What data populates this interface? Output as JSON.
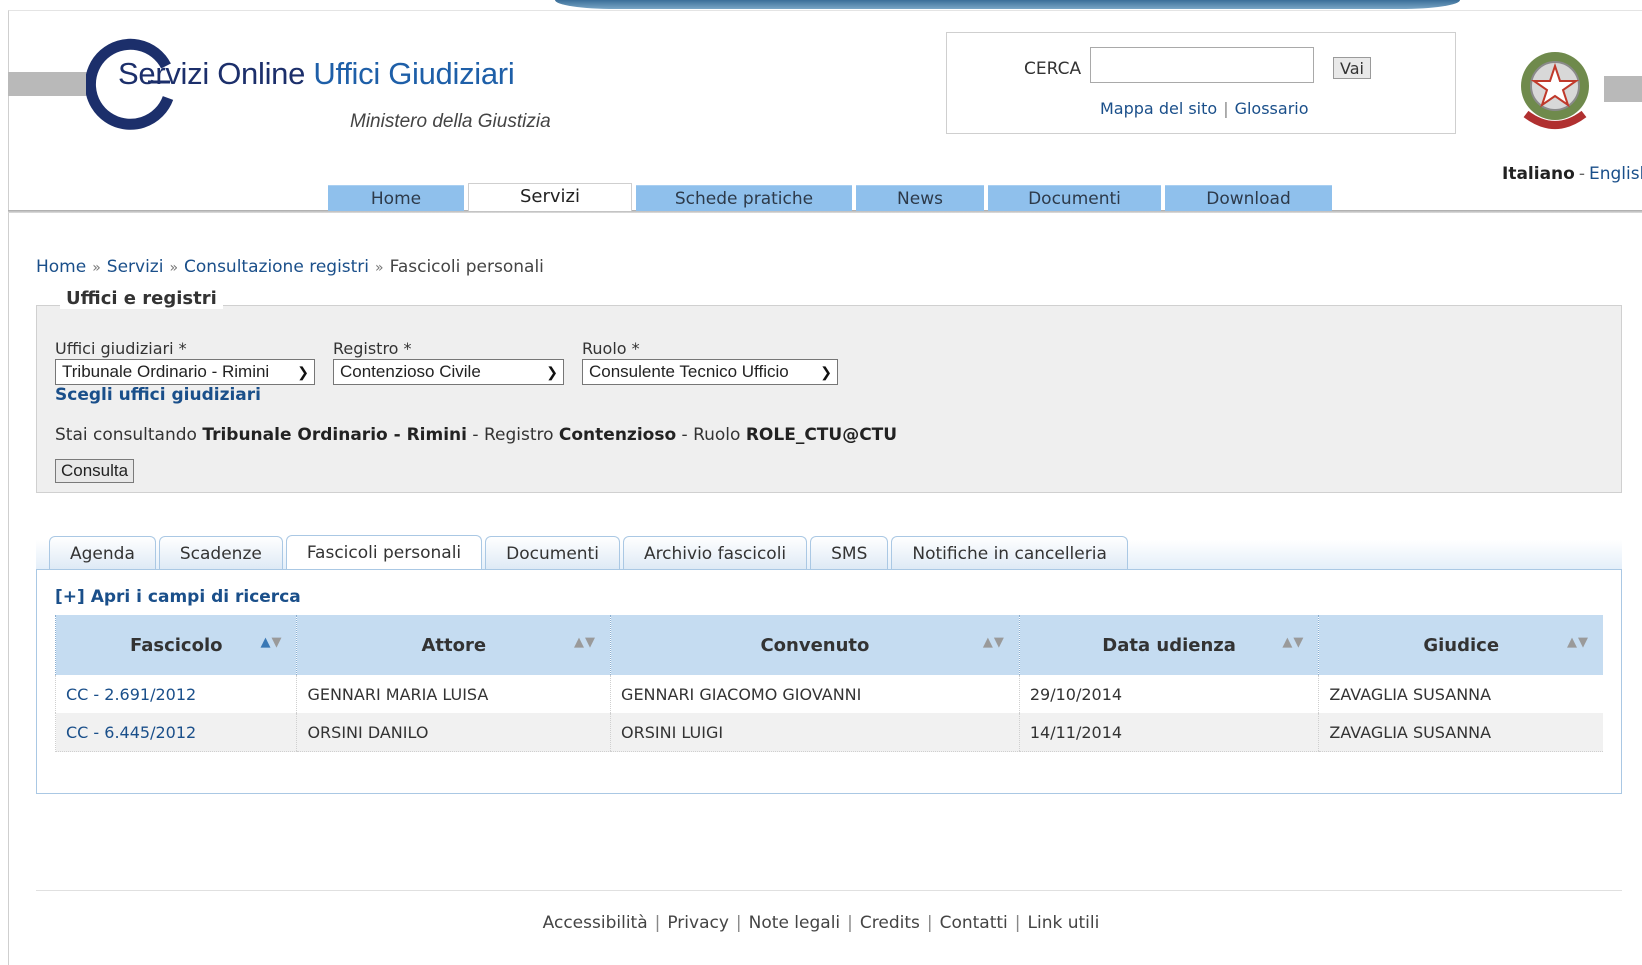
{
  "header": {
    "brand_part1": "Servizi Online",
    "brand_part2": "Uffici Giudiziari",
    "subtitle": "Ministero della Giustizia",
    "search_label": "CERCA",
    "search_value": "",
    "search_button": "Vai",
    "links": [
      "Mappa del sito",
      "Glossario"
    ],
    "lang_current": "Italiano",
    "lang_other": "English",
    "separator_pipe": "|",
    "separator_dash": "-"
  },
  "nav": {
    "items": [
      "Home",
      "Servizi",
      "Schede pratiche",
      "News",
      "Documenti",
      "Download"
    ],
    "active": "Servizi"
  },
  "breadcrumb": [
    "Home",
    "Servizi",
    "Consultazione registri",
    "Fascicoli personali"
  ],
  "form": {
    "legend": "Uffici e registri",
    "uffici_label": "Uffici giudiziari *",
    "uffici_value": "Tribunale Ordinario - Rimini",
    "registro_label": "Registro *",
    "registro_value": "Contenzioso Civile",
    "ruolo_label": "Ruolo *",
    "ruolo_value": "Consulente Tecnico Ufficio",
    "scegli_link": "Scegli uffici giudiziari",
    "status_prefix": "Stai consultando",
    "status_ufficio": "Tribunale Ordinario - Rimini",
    "status_registro_label": "Registro",
    "status_registro": "Contenzioso",
    "status_ruolo_label": "Ruolo",
    "status_ruolo": "ROLE_CTU@CTU",
    "consulta_button": "Consulta"
  },
  "tabs": {
    "items": [
      "Agenda",
      "Scadenze",
      "Fascicoli personali",
      "Documenti",
      "Archivio fascicoli",
      "SMS",
      "Notifiche in cancelleria"
    ],
    "active": "Fascicoli personali"
  },
  "search_toggle": "[+] Apri i campi di ricerca",
  "table": {
    "columns": [
      "Fascicolo",
      "Attore",
      "Convenuto",
      "Data udienza",
      "Giudice"
    ],
    "rows": [
      [
        "CC - 2.691/2012",
        "GENNARI MARIA LUISA",
        "GENNARI GIACOMO GIOVANNI",
        "29/10/2014",
        "ZAVAGLIA SUSANNA"
      ],
      [
        "CC - 6.445/2012",
        "ORSINI DANILO",
        "ORSINI LUIGI",
        "14/11/2014",
        "ZAVAGLIA SUSANNA"
      ]
    ]
  },
  "footer": {
    "links": [
      "Accessibilità",
      "Privacy",
      "Note legali",
      "Credits",
      "Contatti",
      "Link utili"
    ]
  },
  "colors": {
    "brand_dark": "#1c2f6b",
    "brand_blue": "#1e5fa8",
    "nav_tab": "#8fc0ec",
    "link": "#1a4f8a",
    "table_header": "#c5dcf1"
  },
  "icons": [
    "logo-c-icon",
    "emblem-icon",
    "sort-asc-icon",
    "sort-desc-icon",
    "chevron-down-icon"
  ]
}
